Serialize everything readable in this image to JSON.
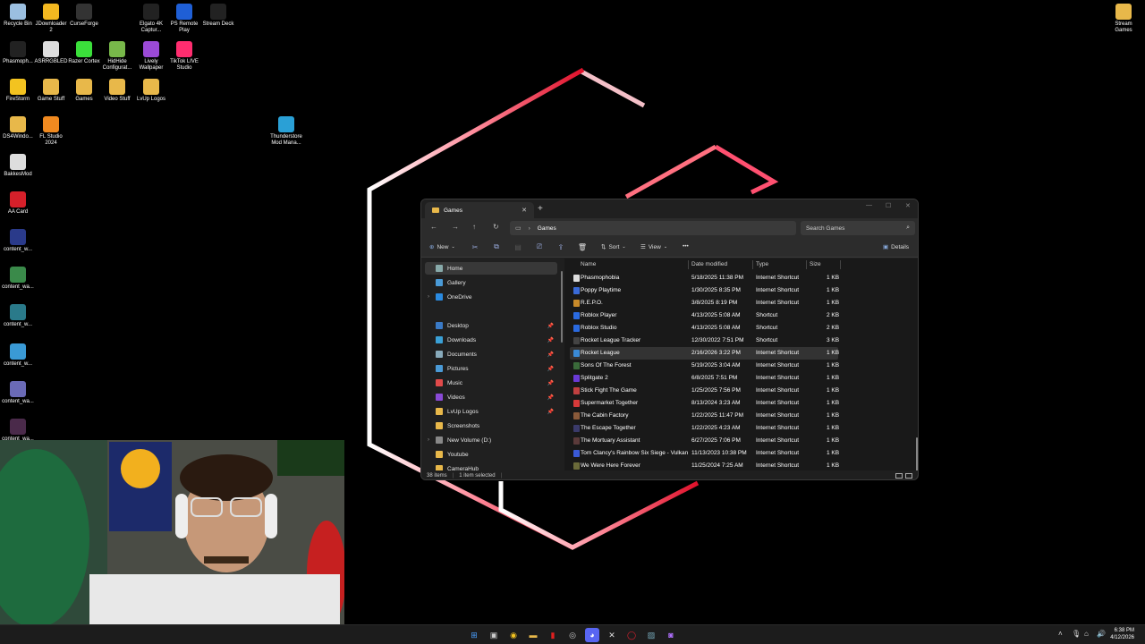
{
  "desktop": {
    "icons": [
      {
        "label": "Recycle Bin",
        "color": "#9bbfe0"
      },
      {
        "label": "JDownloader 2",
        "color": "#f3b820"
      },
      {
        "label": "CurseForge",
        "color": "#333333"
      },
      {
        "label": "Elgato 4K Captur...",
        "color": "#222222"
      },
      {
        "label": "PS Remote Play",
        "color": "#1f5fd6"
      },
      {
        "label": "Stream Deck",
        "color": "#222222"
      },
      {
        "label": "Phasmoph...",
        "color": "#222222"
      },
      {
        "label": "ASRRGBLED",
        "color": "#dddddd"
      },
      {
        "label": "Razer Cortex",
        "color": "#3be03b"
      },
      {
        "label": "HidHide Configurat...",
        "color": "#78b84a"
      },
      {
        "label": "Lively Wallpaper",
        "color": "#9b4ad6"
      },
      {
        "label": "TikTok LIVE Studio",
        "color": "#ff2d6f"
      },
      {
        "label": "FireStorm",
        "color": "#f3c320"
      },
      {
        "label": "Game Stuff",
        "color": "#e8b84a"
      },
      {
        "label": "Games",
        "color": "#e8b84a"
      },
      {
        "label": "Video Stuff",
        "color": "#e8b84a"
      },
      {
        "label": "LvUp Logos",
        "color": "#e8b84a"
      },
      {
        "label": "DS4Windo...",
        "color": "#e8b84a"
      },
      {
        "label": "FL Studio 2024",
        "color": "#f08a20"
      },
      {
        "label": "Thunderstore Mod Mana...",
        "color": "#2aa0d6"
      },
      {
        "label": "BakkesMod",
        "color": "#dddddd"
      },
      {
        "label": "AA Card",
        "color": "#d6202a"
      },
      {
        "label": "content_w...",
        "color": "#2a3a8a"
      },
      {
        "label": "content_wa...",
        "color": "#3a8a4a"
      },
      {
        "label": "content_w...",
        "color": "#2a7a8a"
      },
      {
        "label": "content_w...",
        "color": "#3a9ad6"
      },
      {
        "label": "content_wa...",
        "color": "#6a6ab6"
      },
      {
        "label": "content_wa...",
        "color": "#4a2a4a"
      },
      {
        "label": "Stream Games",
        "color": "#e8b84a"
      }
    ]
  },
  "explorer": {
    "tab_title": "Games",
    "address": "Games",
    "search_placeholder": "Search Games",
    "toolbar": {
      "new": "New",
      "sort": "Sort",
      "view": "View",
      "details": "Details"
    },
    "sidebar": [
      {
        "label": "Home",
        "selected": true
      },
      {
        "label": "Gallery"
      },
      {
        "label": "OneDrive"
      },
      {
        "label": "Desktop",
        "pinned": true
      },
      {
        "label": "Downloads",
        "pinned": true
      },
      {
        "label": "Documents",
        "pinned": true
      },
      {
        "label": "Pictures",
        "pinned": true
      },
      {
        "label": "Music",
        "pinned": true
      },
      {
        "label": "Videos",
        "pinned": true
      },
      {
        "label": "LvUp Logos",
        "pinned": true
      },
      {
        "label": "Screenshots"
      },
      {
        "label": "New Volume (D:)"
      },
      {
        "label": "Youtube"
      },
      {
        "label": "CameraHub"
      }
    ],
    "columns": [
      "Name",
      "Date modified",
      "Type",
      "Size"
    ],
    "files": [
      {
        "name": "Phasmophobia",
        "date": "5/18/2025 11:38 PM",
        "type": "Internet Shortcut",
        "size": "1 KB"
      },
      {
        "name": "Poppy Playtime",
        "date": "1/30/2025 8:35 PM",
        "type": "Internet Shortcut",
        "size": "1 KB"
      },
      {
        "name": "R.E.P.O.",
        "date": "3/8/2025 8:19 PM",
        "type": "Internet Shortcut",
        "size": "1 KB"
      },
      {
        "name": "Roblox Player",
        "date": "4/13/2025 5:08 AM",
        "type": "Shortcut",
        "size": "2 KB"
      },
      {
        "name": "Roblox Studio",
        "date": "4/13/2025 5:08 AM",
        "type": "Shortcut",
        "size": "2 KB"
      },
      {
        "name": "Rocket League Tracker",
        "date": "12/30/2022 7:51 PM",
        "type": "Shortcut",
        "size": "3 KB"
      },
      {
        "name": "Rocket League",
        "date": "2/16/2026 3:22 PM",
        "type": "Internet Shortcut",
        "size": "1 KB"
      },
      {
        "name": "Sons Of The Forest",
        "date": "5/19/2025 3:04 AM",
        "type": "Internet Shortcut",
        "size": "1 KB"
      },
      {
        "name": "Splitgate 2",
        "date": "6/8/2025 7:51 PM",
        "type": "Internet Shortcut",
        "size": "1 KB"
      },
      {
        "name": "Stick Fight The Game",
        "date": "1/25/2025 7:56 PM",
        "type": "Internet Shortcut",
        "size": "1 KB"
      },
      {
        "name": "Supermarket Together",
        "date": "8/13/2024 3:23 AM",
        "type": "Internet Shortcut",
        "size": "1 KB"
      },
      {
        "name": "The Cabin Factory",
        "date": "1/22/2025 11:47 PM",
        "type": "Internet Shortcut",
        "size": "1 KB"
      },
      {
        "name": "The Escape Together",
        "date": "1/22/2025 4:23 AM",
        "type": "Internet Shortcut",
        "size": "1 KB"
      },
      {
        "name": "The Mortuary Assistant",
        "date": "6/27/2025 7:06 PM",
        "type": "Internet Shortcut",
        "size": "1 KB"
      },
      {
        "name": "Tom Clancy's Rainbow Six Siege - Vulkan",
        "date": "11/13/2023 10:38 PM",
        "type": "Internet Shortcut",
        "size": "1 KB"
      },
      {
        "name": "We Were Here Forever",
        "date": "11/25/2024 7:25 AM",
        "type": "Internet Shortcut",
        "size": "1 KB"
      }
    ],
    "status": {
      "items": "38 items",
      "selected": "1 item selected"
    }
  },
  "taskbar": {
    "time": "6:38 PM",
    "date": "4/12/2026"
  }
}
